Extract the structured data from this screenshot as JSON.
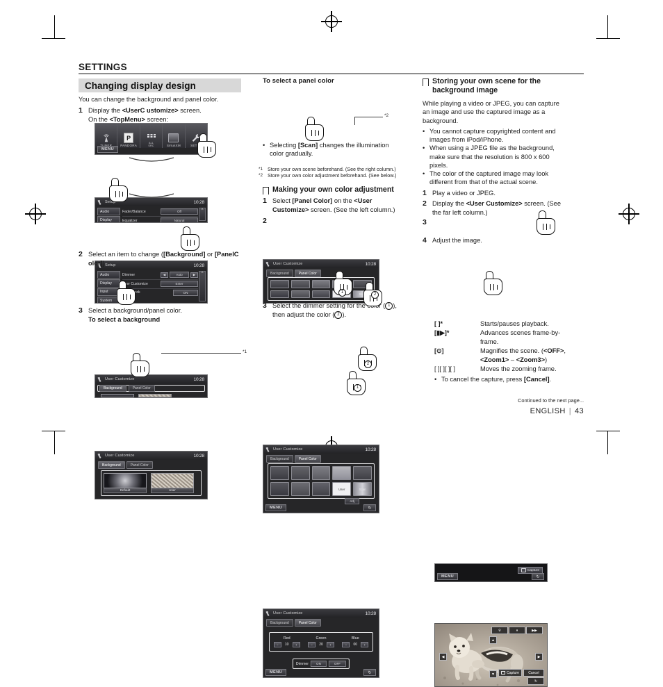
{
  "header": {
    "section": "SETTINGS",
    "title": "Changing display design"
  },
  "left_column": {
    "intro": "You can change the background and panel color.",
    "step1": {
      "num": "1",
      "text_pre": "Display the ",
      "text_bold": "<UserC ustomize>",
      "text_post": " screen.",
      "sub_pre": "On the ",
      "sub_bold": "<TopMenu>",
      "sub_post": " screen:"
    },
    "topmenu_screen": {
      "items": [
        {
          "label": "TUNER",
          "icon": "antenna-icon"
        },
        {
          "label": "PANDORA",
          "icon": "pandora-p-icon"
        },
        {
          "label": "ALL SRC",
          "icon": "grid-icon"
        },
        {
          "label": "SiriusXM",
          "icon": "siriusxm-icon"
        },
        {
          "label": "SETUP",
          "icon": "wrench-icon"
        }
      ],
      "menu_button": "MENU"
    },
    "setup_screen_1": {
      "title": "Setup",
      "clock": "10:28",
      "tabs": [
        "Audio",
        "Display"
      ],
      "rows": [
        {
          "name": "Fader/Balance",
          "value": "Off"
        },
        {
          "name": "Equalizer",
          "value": "Natural"
        }
      ]
    },
    "setup_screen_2": {
      "title": "Setup",
      "clock": "10:28",
      "tabs": [
        "Audio",
        "Display",
        "Input",
        "System"
      ],
      "rows": [
        {
          "name": "Dimmer",
          "value": "Auto"
        },
        {
          "name": "User Customize",
          "value": "Enter"
        },
        {
          "name": "OSD Clock",
          "value": "ON"
        }
      ]
    },
    "step2": {
      "num": "2",
      "text_pre": "Select an item to change (",
      "bold1": "[Background]",
      "mid": " or ",
      "bold2": "[PanelC olor]",
      "text_post": ")."
    },
    "usercustomize_screen": {
      "title": "User Customize",
      "clock": "10:28",
      "tabs": [
        "Background",
        "Panel Color"
      ]
    },
    "step3": {
      "num": "3",
      "text": "Select a background/panel color.",
      "subhead": "To select a background"
    },
    "background_screen": {
      "title": "User Customize",
      "clock": "10:28",
      "tabs": [
        "Background",
        "Panel Color"
      ],
      "thumbs": [
        {
          "caption": "Default"
        },
        {
          "caption": "User"
        }
      ],
      "callout": "*1"
    }
  },
  "middle_column": {
    "panel_head": "To select a panel color",
    "panel_screen": {
      "title": "User Customize",
      "clock": "10:28",
      "tabs": [
        "Background",
        "Panel Color"
      ],
      "swatch_labels": [
        "",
        "",
        "",
        "",
        "",
        "",
        "",
        "",
        "User",
        "Scan"
      ],
      "callout": "*2"
    },
    "panel_bullet_pre": "Selecting ",
    "panel_bullet_bold": "[Scan]",
    "panel_bullet_post": " changes the illumination color gradually.",
    "footnotes": [
      {
        "mark": "*1",
        "text": "Store your own scene beforehand. (See the right column.)"
      },
      {
        "mark": "*2",
        "text": "Store your own color adjustment beforehand. (See below.)"
      }
    ],
    "section2_head": "Making your own color adjustment",
    "step1": {
      "num": "1",
      "pre": "Select ",
      "bold1": "[Panel Color]",
      "mid": " on the ",
      "bold2": "<User Customize>",
      "post": " screen. (See the left column.)"
    },
    "step2": {
      "num": "2"
    },
    "panel_screen_2": {
      "title": "User Customize",
      "clock": "10:28",
      "tabs": [
        "Background",
        "Panel Color"
      ],
      "swatch_labels": [
        "",
        "",
        "",
        "",
        "",
        "",
        "",
        "",
        "User",
        "Scan"
      ],
      "menu_button": "MENU",
      "marker1": "1",
      "marker2": "2"
    },
    "step3": {
      "num": "3",
      "pre": "Select the dimmer setting for the color (",
      "m1": "1",
      "mid": "), then adjust the color (",
      "m2": "2",
      "post": ")."
    },
    "rgb_screen": {
      "title": "User Customize",
      "clock": "10:28",
      "tabs": [
        "Background",
        "Panel Color"
      ],
      "channels": [
        {
          "name": "Red",
          "value": "10",
          "minus": "−",
          "plus": "+"
        },
        {
          "name": "Green",
          "value": "20",
          "minus": "−",
          "plus": "+"
        },
        {
          "name": "Blue",
          "value": "00",
          "minus": "−",
          "plus": "+"
        }
      ],
      "dimmer_label": "Dimmer",
      "dimmer_on": "ON",
      "dimmer_off": "OFF",
      "menu_button": "MENU",
      "marker1": "1",
      "marker2": "2"
    }
  },
  "right_column": {
    "section_head_line1": "Storing your own scene for the",
    "section_head_line2": "background image",
    "intro": "While playing a video or JPEG, you can capture an image and use the captured image as a background.",
    "bullets": [
      "You cannot capture copyrighted content and images from iPod/iPhone.",
      "When using a JPEG file as the background, make sure that the resolution is 800 x 600 pixels.",
      "The color of the captured image may look different from that of the actual scene."
    ],
    "step1": {
      "num": "1",
      "text": "Play a video or JPEG."
    },
    "step2": {
      "num": "2",
      "pre": "Display the ",
      "bold": "<User Customize>",
      "post": " screen. (See the far left column.)"
    },
    "step3": {
      "num": "3"
    },
    "capture_screen": {
      "capture_label": "Capture",
      "menu_button": "MENU"
    },
    "step4": {
      "num": "4",
      "text": "Adjust the image."
    },
    "photo_screen": {
      "zoom_icon": "magnifier-icon",
      "play_pause_icon": "play-pause-icon",
      "frame_advance_icon": "frame-advance-icon",
      "capture_label": "Capture",
      "cancel_label": "Cancel",
      "arrows": [
        "up",
        "down",
        "left",
        "right"
      ]
    },
    "key_table": [
      {
        "key": "[      ]*",
        "desc": "Starts/pauses playback."
      },
      {
        "key": "[▮▶]*",
        "desc": "Advances scenes frame-by-frame."
      },
      {
        "key": "[⊙]",
        "desc_pre": "Magnifies the scene. (",
        "desc_b1": "<OFF>",
        "desc_mid": ", ",
        "desc_b2": "<Zoom1>",
        "desc_mid2": " – ",
        "desc_b3": "<Zoom3>",
        "desc_post": ")"
      },
      {
        "key": "[  ][  ][  ][  ]",
        "desc": "Moves the zooming frame."
      }
    ],
    "cancel_bullet_pre": "To cancel the capture, press ",
    "cancel_bullet_bold": "[Cancel]",
    "cancel_bullet_post": "."
  },
  "footer": {
    "continued": "Continued to the next page...",
    "language": "ENGLISH",
    "separator": "|",
    "page": "43"
  }
}
